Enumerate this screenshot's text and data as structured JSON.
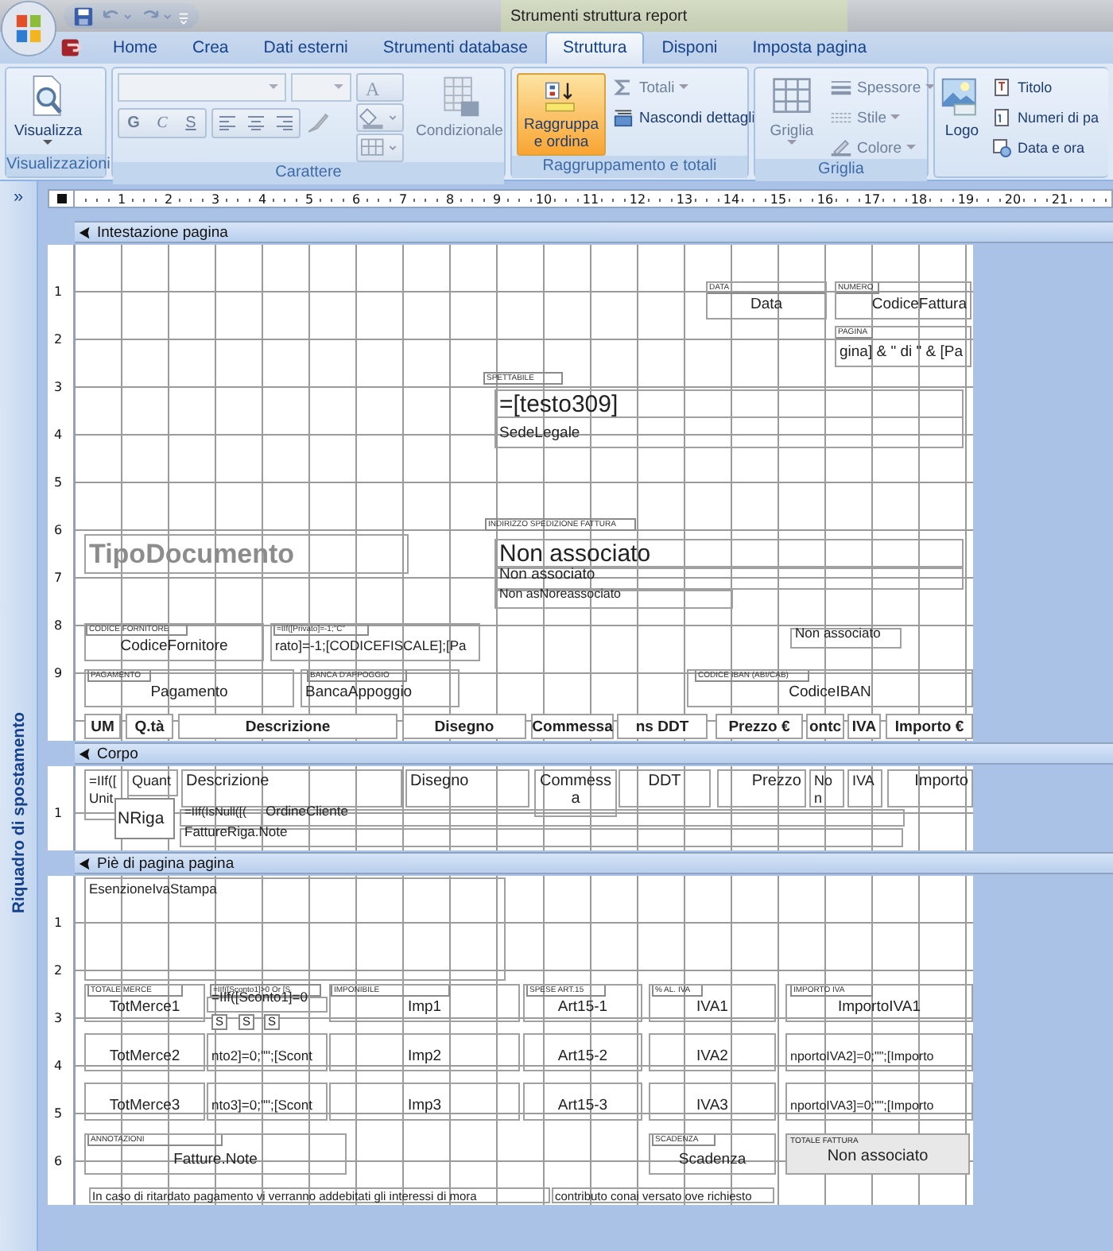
{
  "window": {
    "title": "Strumenti struttura report"
  },
  "tabs": [
    {
      "label": "Home",
      "selected": false
    },
    {
      "label": "Crea",
      "selected": false
    },
    {
      "label": "Dati esterni",
      "selected": false
    },
    {
      "label": "Strumenti database",
      "selected": false
    },
    {
      "label": "Struttura",
      "selected": true
    },
    {
      "label": "Disponi",
      "selected": false
    },
    {
      "label": "Imposta pagina",
      "selected": false
    }
  ],
  "ribbon": {
    "groups": [
      {
        "label": "Visualizzazioni",
        "items": [
          {
            "label": "Visualizza",
            "disabled": false
          }
        ]
      },
      {
        "label": "Carattere",
        "items": [
          {
            "label": "G",
            "disabled": true
          },
          {
            "label": "C",
            "disabled": true
          },
          {
            "label": "S",
            "disabled": true
          },
          {
            "label": "A",
            "disabled": true
          },
          {
            "label": "Condizionale",
            "disabled": true
          }
        ]
      },
      {
        "label": "Raggruppamento e totali",
        "items": [
          {
            "label": "Raggruppa e ordina",
            "selected": true,
            "disabled": false
          },
          {
            "label": "Totali",
            "disabled": true
          },
          {
            "label": "Nascondi dettagli",
            "disabled": false
          }
        ]
      },
      {
        "label": "Griglia",
        "items": [
          {
            "label": "Griglia",
            "disabled": true
          },
          {
            "label": "Spessore",
            "disabled": true
          },
          {
            "label": "Stile",
            "disabled": true
          },
          {
            "label": "Colore",
            "disabled": true
          }
        ]
      },
      {
        "items": [
          {
            "label": "Logo",
            "disabled": false
          },
          {
            "label": "Titolo",
            "disabled": false
          },
          {
            "label": "Numeri di pa",
            "disabled": false
          },
          {
            "label": "Data e ora",
            "disabled": false
          }
        ]
      }
    ]
  },
  "nav_pane": {
    "toggle": "»",
    "label": "Riquadro di spostamento"
  },
  "ruler": {
    "marks": [
      "1",
      "2",
      "3",
      "4",
      "5",
      "6",
      "7",
      "8",
      "9",
      "10",
      "11",
      "12",
      "13",
      "14",
      "15",
      "16",
      "17",
      "18",
      "19",
      "20",
      "21"
    ]
  },
  "sections": [
    {
      "title": "Intestazione pagina",
      "ruler_marks": [
        "1",
        "2",
        "3",
        "4",
        "5",
        "6",
        "7",
        "8",
        "9"
      ],
      "controls": [
        {
          "kind": "caption",
          "text": "DATA"
        },
        {
          "kind": "field",
          "text": "Data"
        },
        {
          "kind": "caption",
          "text": "NUMERO"
        },
        {
          "kind": "field",
          "text": "CodiceFattura"
        },
        {
          "kind": "caption",
          "text": "PAGINA"
        },
        {
          "kind": "field",
          "text": "gina] & \" di \" & [Pa"
        },
        {
          "kind": "caption",
          "text": "SPETTABILE"
        },
        {
          "kind": "large",
          "text": "=[testo309]"
        },
        {
          "kind": "field",
          "text": "SedeLegale"
        },
        {
          "kind": "title",
          "text": "TipoDocumento"
        },
        {
          "kind": "caption",
          "text": "INDIRIZZO SPEDIZIONE FATTURA"
        },
        {
          "kind": "large",
          "text": "Non associato"
        },
        {
          "kind": "field",
          "text": "Non associato"
        },
        {
          "kind": "field",
          "text": "Non asNoreassociato"
        },
        {
          "kind": "caption",
          "text": "CODICE FORNITORE"
        },
        {
          "kind": "field",
          "text": "CodiceFornitore"
        },
        {
          "kind": "caption",
          "text": "=IIf([Privato]=-1;\"C\""
        },
        {
          "kind": "field",
          "text": "rato]=-1;[CODICEFISCALE];[Pa"
        },
        {
          "kind": "field",
          "text": "Non associato"
        },
        {
          "kind": "caption",
          "text": "PAGAMENTO"
        },
        {
          "kind": "field",
          "text": "Pagamento"
        },
        {
          "kind": "caption",
          "text": "BANCA D'APPOGGIO"
        },
        {
          "kind": "field",
          "text": "BancaAppoggio"
        },
        {
          "kind": "caption",
          "text": "CODICE IBAN (ABI/CAB)"
        },
        {
          "kind": "field",
          "text": "CodiceIBAN"
        },
        {
          "kind": "heading",
          "text": "UM"
        },
        {
          "kind": "heading",
          "text": "Q.tà"
        },
        {
          "kind": "heading",
          "text": "Descrizione"
        },
        {
          "kind": "heading",
          "text": "Disegno"
        },
        {
          "kind": "heading",
          "text": "Commessa"
        },
        {
          "kind": "heading",
          "text": "ns DDT"
        },
        {
          "kind": "heading",
          "text": "Prezzo €"
        },
        {
          "kind": "heading",
          "text": "ontc"
        },
        {
          "kind": "heading",
          "text": "IVA"
        },
        {
          "kind": "heading",
          "text": "Importo €"
        }
      ]
    },
    {
      "title": "Corpo",
      "ruler_marks": [
        "1"
      ],
      "controls": [
        {
          "kind": "field",
          "text": "=IIf([ Unit"
        },
        {
          "kind": "field",
          "text": "Quant"
        },
        {
          "kind": "floating",
          "text": "NRiga"
        },
        {
          "kind": "field",
          "text": "Descrizione"
        },
        {
          "kind": "field",
          "text": "Disegno"
        },
        {
          "kind": "field",
          "text": "Commessa"
        },
        {
          "kind": "field",
          "text": "DDT"
        },
        {
          "kind": "field",
          "text": "Prezzo"
        },
        {
          "kind": "field",
          "text": "Non"
        },
        {
          "kind": "field",
          "text": "IVA"
        },
        {
          "kind": "field",
          "text": "Importo"
        },
        {
          "kind": "field",
          "text": "=IIf(IsNull([("
        },
        {
          "kind": "field",
          "text": "OrdineCliente"
        },
        {
          "kind": "field",
          "text": "FattureRiga.Note"
        }
      ]
    },
    {
      "title": "Piè di pagina pagina",
      "ruler_marks": [
        "1",
        "2",
        "3",
        "4",
        "5",
        "6"
      ],
      "controls": [
        {
          "kind": "field",
          "text": "EsenzioneIvaStampa"
        },
        {
          "kind": "caption",
          "text": "TOTALE MERCE"
        },
        {
          "kind": "field",
          "text": "TotMerce1"
        },
        {
          "kind": "caption",
          "text": "=IIf([Sconto1]>0 Or [S"
        },
        {
          "kind": "field",
          "text": "=IIf([Sconto1]=0"
        },
        {
          "kind": "floating",
          "text": "S"
        },
        {
          "kind": "floating",
          "text": "S"
        },
        {
          "kind": "floating",
          "text": "S"
        },
        {
          "kind": "caption",
          "text": "IMPONIBILE"
        },
        {
          "kind": "field",
          "text": "Imp1"
        },
        {
          "kind": "caption",
          "text": "SPESE ART.15"
        },
        {
          "kind": "field",
          "text": "Art15-1"
        },
        {
          "kind": "caption",
          "text": "% AL. IVA"
        },
        {
          "kind": "field",
          "text": "IVA1"
        },
        {
          "kind": "caption",
          "text": "IMPORTO IVA"
        },
        {
          "kind": "field",
          "text": "ImportoIVA1"
        },
        {
          "kind": "field",
          "text": "TotMerce2"
        },
        {
          "kind": "field",
          "text": "nto2]=0;\"\";[Scont"
        },
        {
          "kind": "field",
          "text": "Imp2"
        },
        {
          "kind": "field",
          "text": "Art15-2"
        },
        {
          "kind": "field",
          "text": "IVA2"
        },
        {
          "kind": "field",
          "text": "nportoIVA2]=0;\"\";[Importo"
        },
        {
          "kind": "field",
          "text": "TotMerce3"
        },
        {
          "kind": "field",
          "text": "nto3]=0;\"\";[Scont"
        },
        {
          "kind": "field",
          "text": "Imp3"
        },
        {
          "kind": "field",
          "text": "Art15-3"
        },
        {
          "kind": "field",
          "text": "IVA3"
        },
        {
          "kind": "field",
          "text": "nportoIVA3]=0;\"\";[Importo"
        },
        {
          "kind": "caption",
          "text": "ANNOTAZIONI"
        },
        {
          "kind": "field",
          "text": "Fatture.Note"
        },
        {
          "kind": "caption",
          "text": "SCADENZA"
        },
        {
          "kind": "field",
          "text": "Scadenza"
        },
        {
          "kind": "total",
          "label": "TOTALE FATTURA",
          "text": "Non associato"
        },
        {
          "kind": "note",
          "text": "In caso di ritardato pagamento vi verranno addebitati gli interessi di mora"
        },
        {
          "kind": "note",
          "text": "contributo conai versato ove richiesto"
        }
      ]
    }
  ]
}
